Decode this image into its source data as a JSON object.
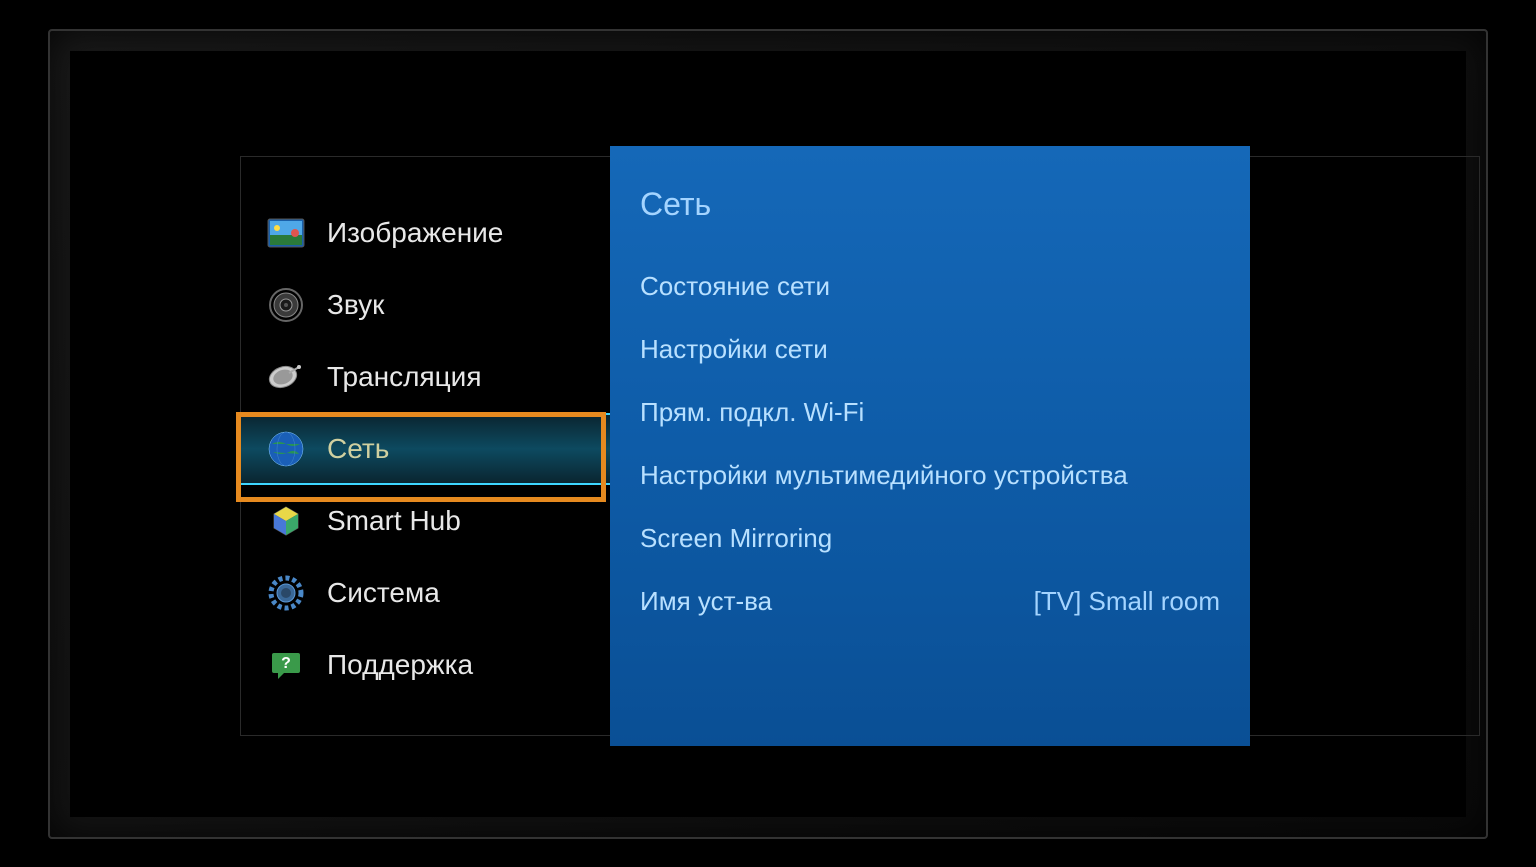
{
  "sidebar": {
    "items": [
      {
        "label": "Изображение",
        "icon": "picture"
      },
      {
        "label": "Звук",
        "icon": "sound"
      },
      {
        "label": "Трансляция",
        "icon": "broadcast"
      },
      {
        "label": "Сеть",
        "icon": "network",
        "selected": true
      },
      {
        "label": "Smart Hub",
        "icon": "smarthub"
      },
      {
        "label": "Система",
        "icon": "system"
      },
      {
        "label": "Поддержка",
        "icon": "support"
      }
    ]
  },
  "panel": {
    "title": "Сеть",
    "items": [
      {
        "label": "Состояние сети"
      },
      {
        "label": "Настройки сети"
      },
      {
        "label": "Прям. подкл. Wi-Fi"
      },
      {
        "label": "Настройки мультимедийного устройства"
      },
      {
        "label": "Screen Mirroring"
      },
      {
        "label": "Имя уст-ва",
        "value": "[TV] Small room"
      }
    ]
  }
}
